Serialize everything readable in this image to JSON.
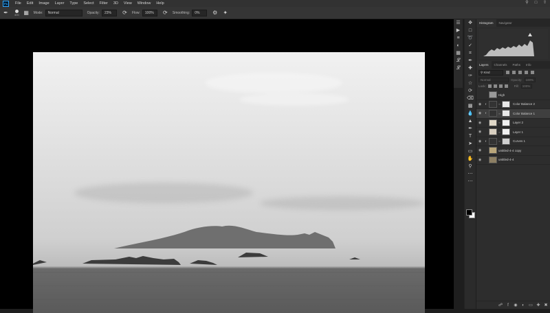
{
  "app": {
    "logo": "Ps",
    "name": "Photoshop"
  },
  "menu": [
    "File",
    "Edit",
    "Image",
    "Layer",
    "Type",
    "Select",
    "Filter",
    "3D",
    "View",
    "Window",
    "Help"
  ],
  "menu_right_icons": [
    "search-icon",
    "workspace-icon",
    "share-icon"
  ],
  "options_bar": {
    "brush_size": "400",
    "mode_label": "Mode:",
    "mode_value": "Normal",
    "opacity_label": "Opacity:",
    "opacity_value": "23%",
    "flow_label": "Flow:",
    "flow_value": "100%",
    "smoothing_label": "Smoothing:",
    "smoothing_value": "0%"
  },
  "panels": {
    "top_tabs": [
      "Histogram",
      "Navigator"
    ],
    "layer_tabs": [
      "Layers",
      "Channels",
      "Paths",
      "Info"
    ],
    "kind_label": "Kind",
    "blend_mode": "Normal",
    "opacity_label": "Opacity:",
    "opacity_value": "100%",
    "lock_label": "Lock:",
    "fill_label": "Fill:",
    "fill_value": "100%"
  },
  "layers": [
    {
      "name": "High",
      "visible": false,
      "adjustment": false,
      "thumb": "#9a9a9a",
      "mask": null,
      "selected": false
    },
    {
      "name": "Color Balance 2",
      "visible": true,
      "adjustment": true,
      "thumb": "#333333",
      "mask": "#e8e8e8",
      "selected": false
    },
    {
      "name": "Color Balance 1",
      "visible": true,
      "adjustment": true,
      "thumb": "#333333",
      "mask": "#e8e8e8",
      "selected": true
    },
    {
      "name": "Layer 2",
      "visible": true,
      "adjustment": false,
      "thumb": "#e0d8c8",
      "mask": "#f0f0f0",
      "selected": false
    },
    {
      "name": "Layer 1",
      "visible": true,
      "adjustment": false,
      "thumb": "#d8cfc0",
      "mask": "#f0f0f0",
      "selected": false
    },
    {
      "name": "Curves 1",
      "visible": true,
      "adjustment": true,
      "thumb": "#333333",
      "mask": "#cfcfcf",
      "selected": false
    },
    {
      "name": "untitled-4-4 copy",
      "visible": true,
      "adjustment": false,
      "thumb": "#b9a67a",
      "mask": null,
      "selected": false
    },
    {
      "name": "untitled-4-4",
      "visible": true,
      "adjustment": false,
      "thumb": "#8d7f63",
      "mask": null,
      "selected": false
    }
  ],
  "footer_icons": [
    "link-icon",
    "fx-icon",
    "mask-icon",
    "adjustment-icon",
    "group-icon",
    "new-layer-icon",
    "trash-icon"
  ],
  "colors": {
    "accent": "#31a8ff",
    "canvas_bg": "#000000",
    "panel_bg": "#2d2d2d"
  }
}
